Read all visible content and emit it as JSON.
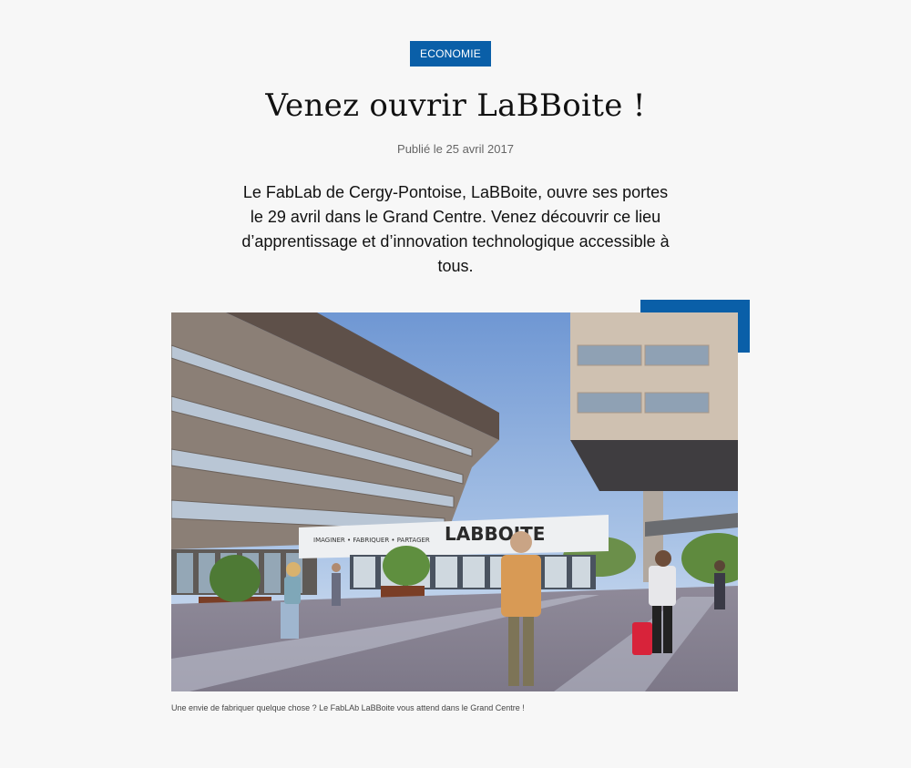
{
  "article": {
    "category": "ECONOMIE",
    "title": "Venez ouvrir LaBBoite !",
    "published": "Publié le 25 avril 2017",
    "intro": "Le FabLab de Cergy-Pontoise, LaBBoite, ouvre ses portes le 29 avril dans le Grand Centre. Venez découvrir ce lieu d’apprentissage et d’innovation technologique accessible à tous.",
    "image": {
      "sign_logo": "LABBOITE",
      "sign_slogan": "IMAGINER • FABRIQUER • PARTAGER"
    },
    "caption": "Une envie de fabriquer quelque chose ? Le FabLAb LaBBoite vous attend dans le Grand Centre !"
  },
  "colors": {
    "accent": "#0a5fa8",
    "background": "#f7f7f7"
  }
}
